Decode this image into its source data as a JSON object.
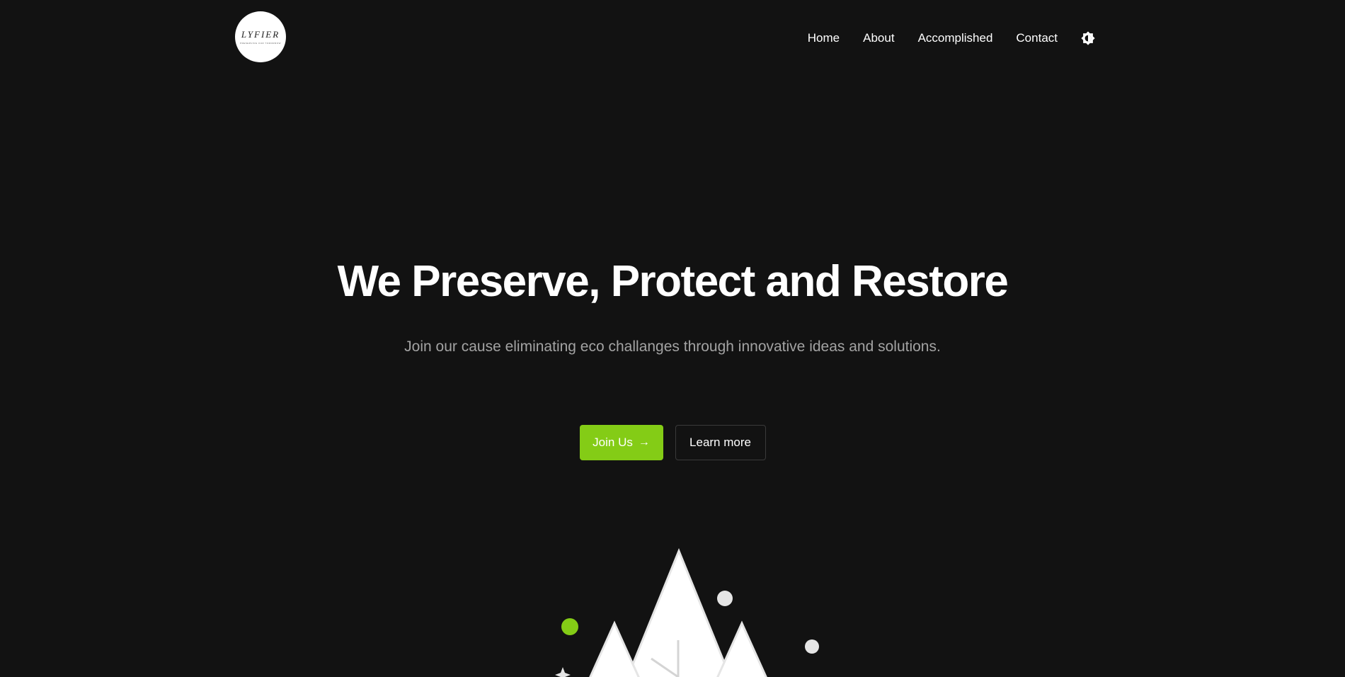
{
  "header": {
    "logo": {
      "wordmark": "LYFIER",
      "tagline": "PRESERVING OUR TOMORROW"
    },
    "nav": [
      {
        "label": "Home"
      },
      {
        "label": "About"
      },
      {
        "label": "Accomplished"
      },
      {
        "label": "Contact"
      }
    ],
    "theme_toggle": {
      "icon": "theme-toggle-icon"
    }
  },
  "hero": {
    "title": "We Preserve, Protect and Restore",
    "subtitle": "Join our cause eliminating eco challanges through innovative ideas and solutions.",
    "primary_button": {
      "label": "Join Us",
      "icon": "arrow-right-icon"
    },
    "secondary_button": {
      "label": "Learn more"
    }
  },
  "colors": {
    "background": "#121212",
    "accent": "#84cc16",
    "text": "#ffffff",
    "muted_text": "#a3a3a3"
  }
}
